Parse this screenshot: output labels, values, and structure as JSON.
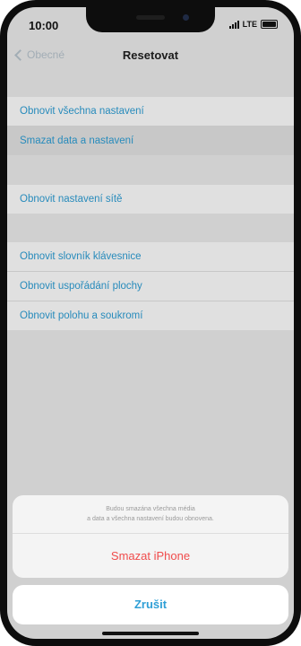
{
  "status_bar": {
    "time": "10:00",
    "network": "LTE"
  },
  "nav": {
    "back_label": "Obecné",
    "title": "Resetovat"
  },
  "groups": {
    "reset": [
      {
        "label": "Obnovit všechna nastavení"
      },
      {
        "label": "Smazat data a nastavení"
      }
    ],
    "network": [
      {
        "label": "Obnovit nastavení sítě"
      }
    ],
    "other": [
      {
        "label": "Obnovit slovník klávesnice"
      },
      {
        "label": "Obnovit uspořádání plochy"
      },
      {
        "label": "Obnovit polohu a soukromí"
      }
    ]
  },
  "action_sheet": {
    "message_line1": "Budou smazána všechna média",
    "message_line2": "a data a všechna nastavení budou obnovena.",
    "destructive_label": "Smazat iPhone",
    "cancel_label": "Zrušit"
  },
  "colors": {
    "accent": "#2e9fd6",
    "destructive": "#f04c4c",
    "background": "#ededed"
  }
}
